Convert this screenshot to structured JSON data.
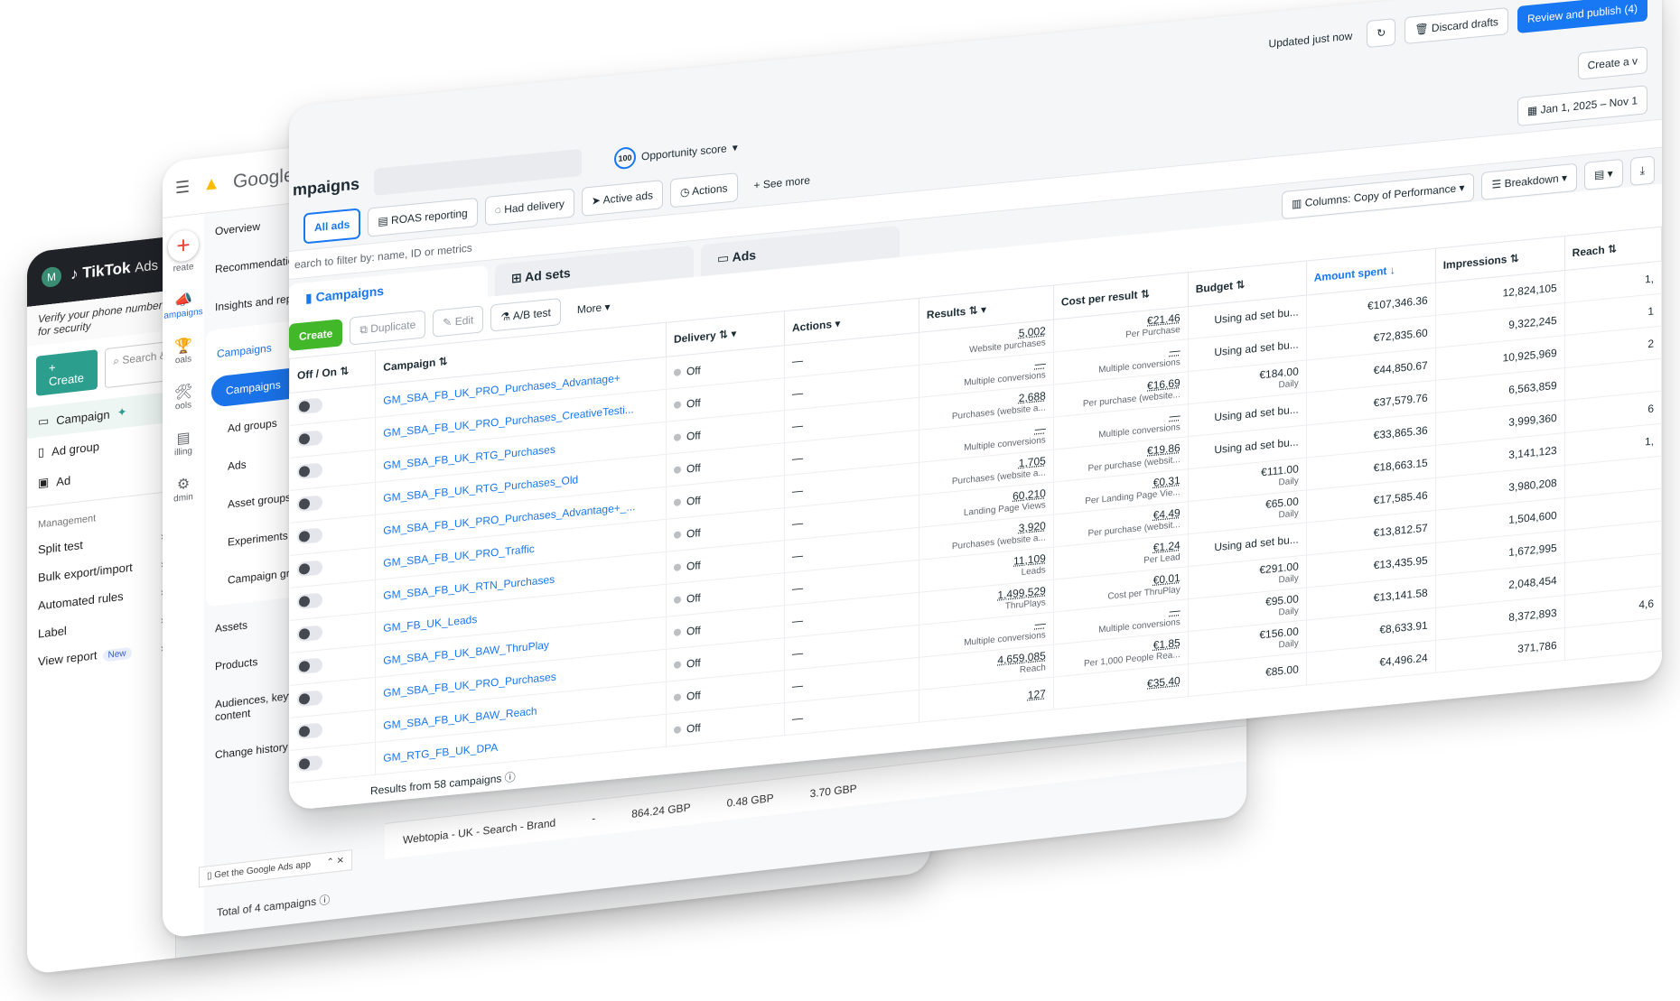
{
  "tiktok": {
    "avatar": "M",
    "logo": "TikTok",
    "logo_sub": "Ads Manag",
    "verify": "Verify your phone number for security",
    "create": "+ Create",
    "search": "Search &",
    "items": [
      "Campaign",
      "Ad group",
      "Ad"
    ],
    "management_label": "Management",
    "management": [
      "Split test",
      "Bulk export/import",
      "Automated rules",
      "Label",
      "View report"
    ],
    "new_badge": "New"
  },
  "google": {
    "title": "Google Ad",
    "rail": [
      {
        "icon": "+",
        "label": "reate"
      },
      {
        "icon": "📣",
        "label": "ampaigns"
      },
      {
        "icon": "🏆",
        "label": "oals"
      },
      {
        "icon": "🛠",
        "label": "ools"
      },
      {
        "icon": "▤",
        "label": "illing"
      },
      {
        "icon": "⚙",
        "label": "dmin"
      }
    ],
    "nav_top": [
      "Overview",
      "Recommendation",
      "Insights and repo"
    ],
    "nav_group": {
      "header": "Campaigns",
      "selected": "Campaigns",
      "items": [
        "Ad groups",
        "Ads",
        "Asset groups",
        "Experiments",
        "Campaign grou"
      ]
    },
    "nav_bottom": [
      "Assets",
      "Products",
      "Audiences, keyw content",
      "Change history"
    ],
    "app_banner": "Get the Google Ads app",
    "rows": [
      "Webtopia - UK - Search - Brand",
      "-",
      "864.24 GBP",
      "0.48 GBP",
      "3.70 GBP"
    ],
    "total": "Total of 4 campaigns"
  },
  "meta": {
    "updated": "Updated just now",
    "discard": "Discard drafts",
    "publish": "Review and publish (4)",
    "page_title": "mpaigns",
    "opp_score": "100",
    "opp_label": "Opportunity score",
    "create_a": "Create a v",
    "chips": [
      "All ads",
      "ROAS reporting",
      "Had delivery",
      "Active ads",
      "Actions",
      "+ See more"
    ],
    "date": "Jan 1, 2025 – Nov 1",
    "search_placeholder": "earch to filter by: name, ID or metrics",
    "tabs": [
      "Campaigns",
      "Ad sets",
      "Ads"
    ],
    "columns_btn": "Columns: Copy of Performance",
    "breakdown_btn": "Breakdown",
    "actions": [
      "Create",
      "Duplicate",
      "Edit",
      "A/B test",
      "More"
    ],
    "headers": [
      "Off / On",
      "Campaign",
      "Delivery",
      "Actions",
      "Results",
      "Cost per result",
      "Budget",
      "Amount spent",
      "Impressions",
      "Reach"
    ],
    "rows": [
      {
        "name": "GM_SBA_FB_UK_PRO_Purchases_Advantage+",
        "delivery": "Off",
        "actions": "—",
        "result": "5,002",
        "result_sub": "Website purchases",
        "cost": "€21.46",
        "cost_sub": "Per Purchase",
        "budget": "Using ad set bu...",
        "budget_sub": "",
        "spent": "€107,346.36",
        "impr": "12,824,105",
        "reach": "1,"
      },
      {
        "name": "GM_SBA_FB_UK_PRO_Purchases_CreativeTesti...",
        "delivery": "Off",
        "actions": "—",
        "result": "—",
        "result_sub": "Multiple conversions",
        "cost": "—",
        "cost_sub": "Multiple conversions",
        "budget": "Using ad set bu...",
        "budget_sub": "",
        "spent": "€72,835.60",
        "impr": "9,322,245",
        "reach": "1"
      },
      {
        "name": "GM_SBA_FB_UK_RTG_Purchases",
        "delivery": "Off",
        "actions": "—",
        "result": "2,688",
        "result_sub": "Purchases (website a...",
        "cost": "€16.69",
        "cost_sub": "Per purchase (website...",
        "budget": "€184.00",
        "budget_sub": "Daily",
        "spent": "€44,850.67",
        "impr": "10,925,969",
        "reach": "2"
      },
      {
        "name": "GM_SBA_FB_UK_RTG_Purchases_Old",
        "delivery": "Off",
        "actions": "—",
        "result": "—",
        "result_sub": "Multiple conversions",
        "cost": "—",
        "cost_sub": "Multiple conversions",
        "budget": "Using ad set bu...",
        "budget_sub": "",
        "spent": "€37,579.76",
        "impr": "6,563,859",
        "reach": ""
      },
      {
        "name": "GM_SBA_FB_UK_PRO_Purchases_Advantage+_...",
        "delivery": "Off",
        "actions": "—",
        "result": "1,705",
        "result_sub": "Purchases (website a...",
        "cost": "€19.86",
        "cost_sub": "Per purchase (websit...",
        "budget": "Using ad set bu...",
        "budget_sub": "",
        "spent": "€33,865.36",
        "impr": "3,999,360",
        "reach": "6"
      },
      {
        "name": "GM_SBA_FB_UK_PRO_Traffic",
        "delivery": "Off",
        "actions": "—",
        "result": "60,210",
        "result_sub": "Landing Page Views",
        "cost": "€0.31",
        "cost_sub": "Per Landing Page Vie...",
        "budget": "€111.00",
        "budget_sub": "Daily",
        "spent": "€18,663.15",
        "impr": "3,141,123",
        "reach": "1,"
      },
      {
        "name": "GM_SBA_FB_UK_RTN_Purchases",
        "delivery": "Off",
        "actions": "—",
        "result": "3,920",
        "result_sub": "Purchases (website a...",
        "cost": "€4.49",
        "cost_sub": "Per purchase (websit...",
        "budget": "€65.00",
        "budget_sub": "Daily",
        "spent": "€17,585.46",
        "impr": "3,980,208",
        "reach": ""
      },
      {
        "name": "GM_FB_UK_Leads",
        "delivery": "Off",
        "actions": "—",
        "result": "11,109",
        "result_sub": "Leads",
        "cost": "€1.24",
        "cost_sub": "Per Lead",
        "budget": "Using ad set bu...",
        "budget_sub": "",
        "spent": "€13,812.57",
        "impr": "1,504,600",
        "reach": ""
      },
      {
        "name": "GM_SBA_FB_UK_BAW_ThruPlay",
        "delivery": "Off",
        "actions": "—",
        "result": "1,499,529",
        "result_sub": "ThruPlays",
        "cost": "€0.01",
        "cost_sub": "Cost per ThruPlay",
        "budget": "€291.00",
        "budget_sub": "Daily",
        "spent": "€13,435.95",
        "impr": "1,672,995",
        "reach": ""
      },
      {
        "name": "GM_SBA_FB_UK_PRO_Purchases",
        "delivery": "Off",
        "actions": "—",
        "result": "—",
        "result_sub": "Multiple conversions",
        "cost": "—",
        "cost_sub": "Multiple conversions",
        "budget": "€95.00",
        "budget_sub": "Daily",
        "spent": "€13,141.58",
        "impr": "2,048,454",
        "reach": ""
      },
      {
        "name": "GM_SBA_FB_UK_BAW_Reach",
        "delivery": "Off",
        "actions": "—",
        "result": "4,659,085",
        "result_sub": "Reach",
        "cost": "€1.85",
        "cost_sub": "Per 1,000 People Rea...",
        "budget": "€156.00",
        "budget_sub": "Daily",
        "spent": "€8,633.91",
        "impr": "8,372,893",
        "reach": "4,6"
      },
      {
        "name": "GM_RTG_FB_UK_DPA",
        "delivery": "Off",
        "actions": "—",
        "result": "127",
        "result_sub": "",
        "cost": "€35.40",
        "cost_sub": "",
        "budget": "€85.00",
        "budget_sub": "",
        "spent": "€4,496.24",
        "impr": "371,786",
        "reach": ""
      }
    ],
    "footer": "Results from 58 campaigns ⓘ"
  }
}
